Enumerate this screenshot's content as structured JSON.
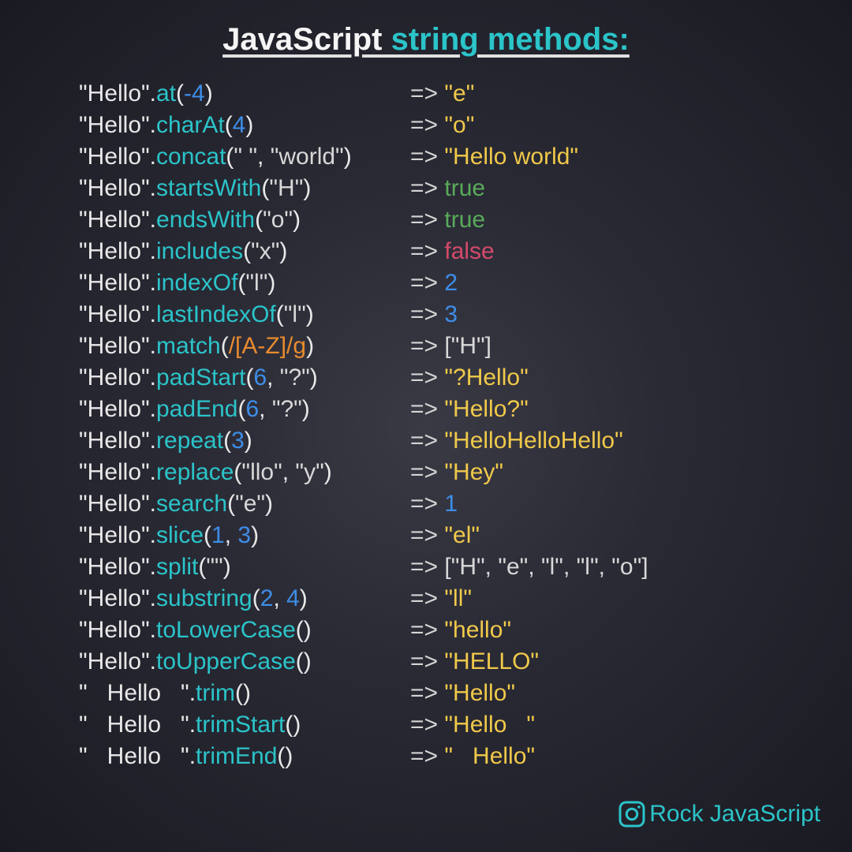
{
  "title": {
    "white": "JavaScript",
    "teal": " string methods:"
  },
  "footer": "Rock JavaScript",
  "rows": [
    {
      "base": "\"Hello\"",
      "method": "at",
      "args": [
        {
          "t": "num",
          "v": "-4"
        }
      ],
      "res": {
        "t": "str",
        "v": "\"e\""
      }
    },
    {
      "base": "\"Hello\"",
      "method": "charAt",
      "args": [
        {
          "t": "num",
          "v": "4"
        }
      ],
      "res": {
        "t": "str",
        "v": "\"o\""
      }
    },
    {
      "base": "\"Hello\"",
      "method": "concat",
      "args": [
        {
          "t": "arg-str",
          "v": "\" \""
        },
        {
          "t": "arg-str",
          "v": "\"world\""
        }
      ],
      "res": {
        "t": "str",
        "v": "\"Hello world\""
      }
    },
    {
      "base": "\"Hello\"",
      "method": "startsWith",
      "args": [
        {
          "t": "arg-str",
          "v": "\"H\""
        }
      ],
      "res": {
        "t": "true",
        "v": "true"
      }
    },
    {
      "base": "\"Hello\"",
      "method": "endsWith",
      "args": [
        {
          "t": "arg-str",
          "v": "\"o\""
        }
      ],
      "res": {
        "t": "true",
        "v": "true"
      }
    },
    {
      "base": "\"Hello\"",
      "method": "includes",
      "args": [
        {
          "t": "arg-str",
          "v": "\"x\""
        }
      ],
      "res": {
        "t": "false",
        "v": "false"
      }
    },
    {
      "base": "\"Hello\"",
      "method": "indexOf",
      "args": [
        {
          "t": "arg-str",
          "v": "\"l\""
        }
      ],
      "res": {
        "t": "num",
        "v": "2"
      }
    },
    {
      "base": "\"Hello\"",
      "method": "lastIndexOf",
      "args": [
        {
          "t": "arg-str",
          "v": "\"l\""
        }
      ],
      "res": {
        "t": "num",
        "v": "3"
      }
    },
    {
      "base": "\"Hello\"",
      "method": "match",
      "args": [
        {
          "t": "regex",
          "v": "/[A-Z]/g"
        }
      ],
      "res": {
        "t": "arr",
        "v": "[\"H\"]"
      }
    },
    {
      "base": "\"Hello\"",
      "method": "padStart",
      "args": [
        {
          "t": "num",
          "v": "6"
        },
        {
          "t": "arg-str",
          "v": "\"?\""
        }
      ],
      "res": {
        "t": "str",
        "v": "\"?Hello\""
      }
    },
    {
      "base": "\"Hello\"",
      "method": "padEnd",
      "args": [
        {
          "t": "num",
          "v": "6"
        },
        {
          "t": "arg-str",
          "v": "\"?\""
        }
      ],
      "res": {
        "t": "str",
        "v": "\"Hello?\""
      }
    },
    {
      "base": "\"Hello\"",
      "method": "repeat",
      "args": [
        {
          "t": "num",
          "v": "3"
        }
      ],
      "res": {
        "t": "str",
        "v": "\"HelloHelloHello\""
      }
    },
    {
      "base": "\"Hello\"",
      "method": "replace",
      "args": [
        {
          "t": "arg-str",
          "v": "\"llo\""
        },
        {
          "t": "arg-str",
          "v": "\"y\""
        }
      ],
      "res": {
        "t": "str",
        "v": "\"Hey\""
      }
    },
    {
      "base": "\"Hello\"",
      "method": "search",
      "args": [
        {
          "t": "arg-str",
          "v": "\"e\""
        }
      ],
      "res": {
        "t": "num",
        "v": "1"
      }
    },
    {
      "base": "\"Hello\"",
      "method": "slice",
      "args": [
        {
          "t": "num",
          "v": "1"
        },
        {
          "t": "num",
          "v": "3"
        }
      ],
      "res": {
        "t": "str",
        "v": "\"el\""
      }
    },
    {
      "base": "\"Hello\"",
      "method": "split",
      "args": [
        {
          "t": "arg-str",
          "v": "\"\""
        }
      ],
      "res": {
        "t": "arr",
        "v": "[\"H\", \"e\", \"l\", \"l\", \"o\"]"
      }
    },
    {
      "base": "\"Hello\"",
      "method": "substring",
      "args": [
        {
          "t": "num",
          "v": "2"
        },
        {
          "t": "num",
          "v": "4"
        }
      ],
      "res": {
        "t": "str",
        "v": "\"ll\""
      }
    },
    {
      "base": "\"Hello\"",
      "method": "toLowerCase",
      "args": [],
      "res": {
        "t": "str",
        "v": "\"hello\""
      }
    },
    {
      "base": "\"Hello\"",
      "method": "toUpperCase",
      "args": [],
      "res": {
        "t": "str",
        "v": "\"HELLO\""
      }
    },
    {
      "base": "\"   Hello   \"",
      "method": "trim",
      "args": [],
      "res": {
        "t": "str",
        "v": "\"Hello\""
      }
    },
    {
      "base": "\"   Hello   \"",
      "method": "trimStart",
      "args": [],
      "res": {
        "t": "str",
        "v": "\"Hello   \""
      }
    },
    {
      "base": "\"   Hello   \"",
      "method": "trimEnd",
      "args": [],
      "res": {
        "t": "str",
        "v": "\"   Hello\""
      }
    }
  ]
}
